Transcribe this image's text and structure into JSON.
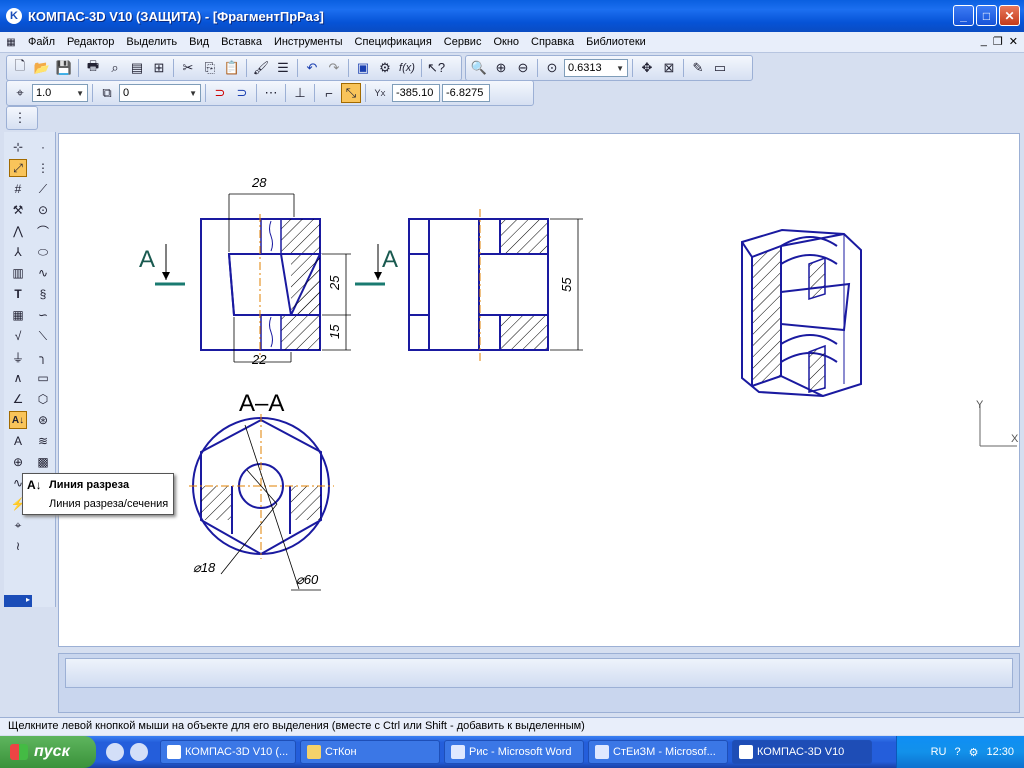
{
  "window": {
    "title": "КОМПАС-3D V10 (ЗАЩИТА) - [ФрагментПрРаз]",
    "logo": "K"
  },
  "menu": [
    "Файл",
    "Редактор",
    "Выделить",
    "Вид",
    "Вставка",
    "Инструменты",
    "Спецификация",
    "Сервис",
    "Окно",
    "Справка",
    "Библиотеки"
  ],
  "toolbar": {
    "zoom_value": "0.6313",
    "line_scale": "1.0",
    "layer": "0",
    "x_value": "-385.10",
    "y_value": "-6.8275"
  },
  "drawing": {
    "section_label_left": "A",
    "section_label_right": "A",
    "section_title": "A–A",
    "dims": {
      "top_width": "28",
      "bottom_width": "22",
      "h1": "25",
      "h2": "15",
      "overall_height": "55",
      "dia_small": "⌀18",
      "dia_large": "⌀60"
    },
    "axis_y": "Y",
    "axis_x": "X"
  },
  "tooltip": {
    "title": "Линия разреза",
    "subtitle": "Линия разреза/сечения"
  },
  "status": {
    "hint": "Щелкните левой кнопкой мыши на объекте для его выделения (вместе с Ctrl или Shift - добавить к выделенным)"
  },
  "taskbar": {
    "start": "пуск",
    "items": [
      {
        "label": "КОМПАС-3D V10 (...",
        "active": false
      },
      {
        "label": "СтКон",
        "active": false
      },
      {
        "label": "Рис - Microsoft Word",
        "active": false
      },
      {
        "label": "СтЕиЗМ - Microsof...",
        "active": false
      },
      {
        "label": "КОМПАС-3D V10",
        "active": true
      }
    ],
    "lang": "RU",
    "clock": "12:30"
  }
}
